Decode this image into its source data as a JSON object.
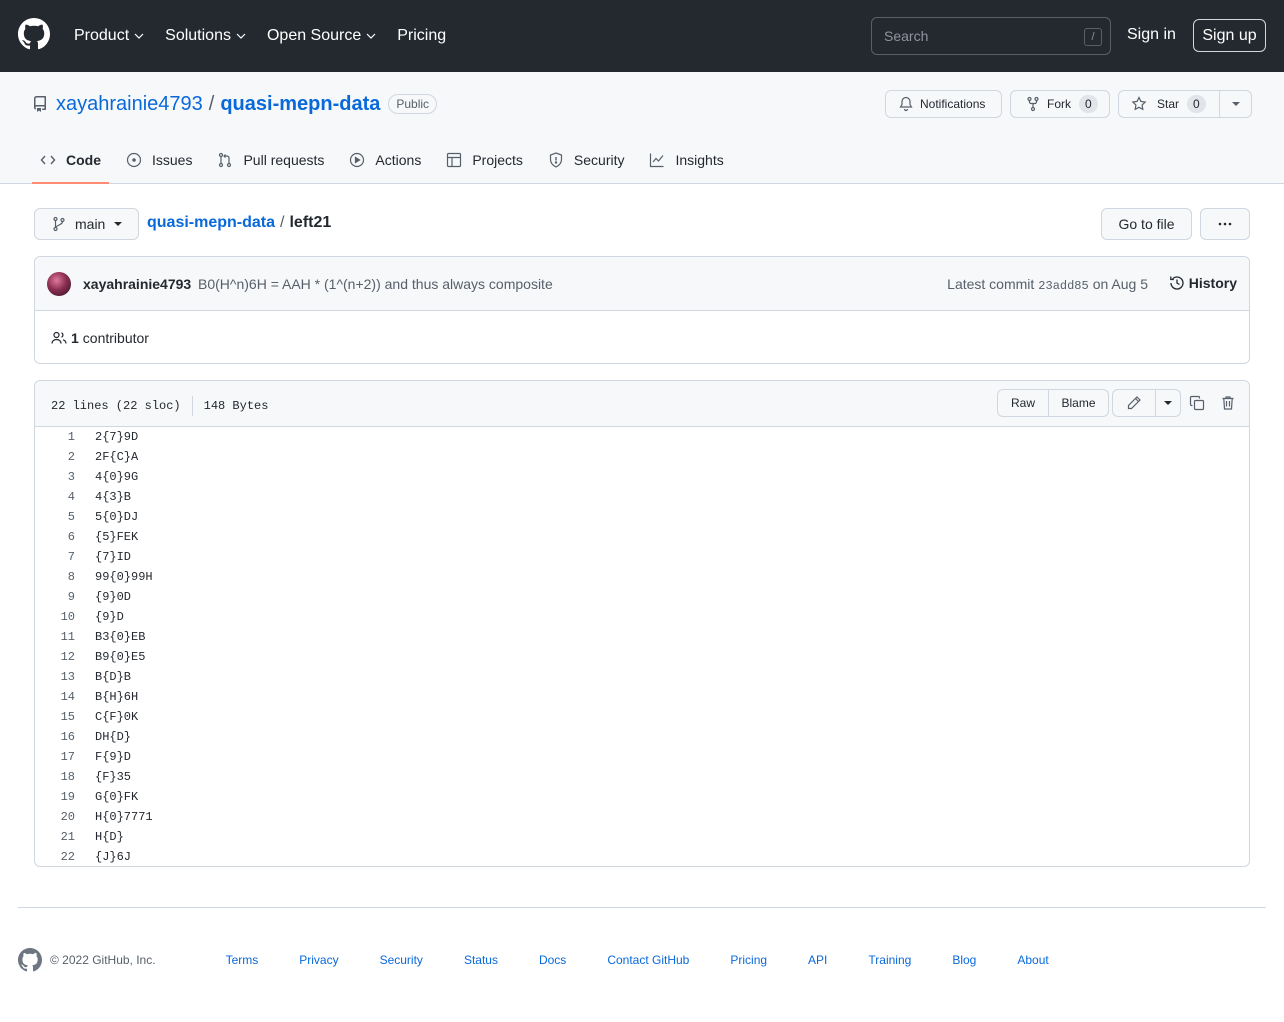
{
  "header": {
    "nav": [
      "Product",
      "Solutions",
      "Open Source",
      "Pricing"
    ],
    "search_placeholder": "Search",
    "search_shortcut": "/",
    "sign_in": "Sign in",
    "sign_up": "Sign up"
  },
  "repo": {
    "owner": "xayahrainie4793",
    "separator": "/",
    "name": "quasi-mepn-data",
    "visibility": "Public",
    "notifications_label": "Notifications",
    "fork_label": "Fork",
    "fork_count": "0",
    "star_label": "Star",
    "star_count": "0"
  },
  "tabs": [
    {
      "label": "Code",
      "icon": "code-icon",
      "active": true
    },
    {
      "label": "Issues",
      "icon": "issue-icon"
    },
    {
      "label": "Pull requests",
      "icon": "pull-request-icon"
    },
    {
      "label": "Actions",
      "icon": "play-icon"
    },
    {
      "label": "Projects",
      "icon": "table-icon"
    },
    {
      "label": "Security",
      "icon": "shield-icon"
    },
    {
      "label": "Insights",
      "icon": "graph-icon"
    }
  ],
  "file_nav": {
    "branch": "main",
    "repo_crumb": "quasi-mepn-data",
    "crumb_sep": "/",
    "file_name": "left21",
    "go_to_file": "Go to file"
  },
  "commit": {
    "author": "xayahrainie4793",
    "message": "B0(H^n)6H = AAH * (1^(n+2)) and thus always composite",
    "latest_prefix": "Latest commit",
    "sha": "23add85",
    "date": "on Aug 5",
    "history": "History",
    "contributor_count": "1",
    "contributor_label": "contributor"
  },
  "file": {
    "lines_info": "22 lines (22 sloc)",
    "size": "148 Bytes",
    "raw": "Raw",
    "blame": "Blame",
    "lines": [
      "2{7}9D",
      "2F{C}A",
      "4{0}9G",
      "4{3}B",
      "5{0}DJ",
      "{5}FEK",
      "{7}ID",
      "99{0}99H",
      "{9}0D",
      "{9}D",
      "B3{0}EB",
      "B9{0}E5",
      "B{D}B",
      "B{H}6H",
      "C{F}0K",
      "DH{D}",
      "F{9}D",
      "{F}35",
      "G{0}FK",
      "H{0}7771",
      "H{D}",
      "{J}6J"
    ]
  },
  "footer": {
    "copyright": "© 2022 GitHub, Inc.",
    "links": [
      "Terms",
      "Privacy",
      "Security",
      "Status",
      "Docs",
      "Contact GitHub",
      "Pricing",
      "API",
      "Training",
      "Blog",
      "About"
    ]
  },
  "colors": {
    "header_bg": "#24292f",
    "link": "#0969da",
    "tab_underline": "#fd8c73",
    "border": "#d0d7de"
  }
}
